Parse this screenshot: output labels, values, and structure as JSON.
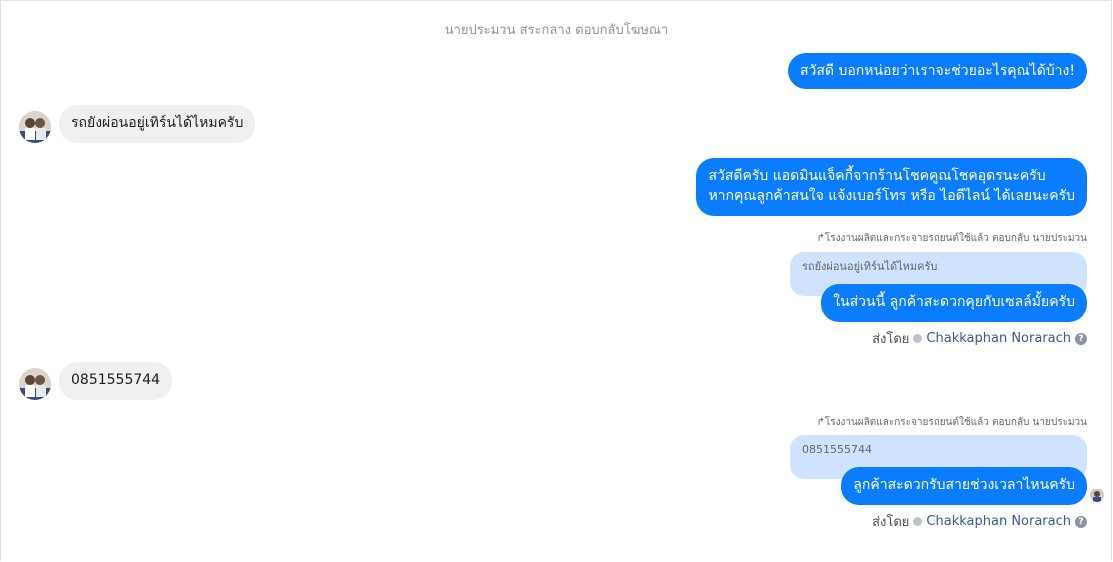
{
  "header": {
    "thread_title": "นายประมวน สระกลาง ตอบกลับโฆษณา"
  },
  "messages": {
    "m1": "สวัสดี บอกหน่อยว่าเราจะช่วยอะไรคุณได้บ้าง!",
    "m2": "รถยังผ่อนอยู่เทิร์นได้ไหมครับ",
    "m3_line1": "สวัสดีครับ แอดมินแจ็คกี้จากร้านโชคคูณโชคอุดรนะครับ",
    "m3_line2": "หากคุณลูกค้าสนใจ แจ้งเบอร์โทร หรือ ไอดีไลน์ ได้เลยนะครับ",
    "reply1_meta": "โรงงานผลิตและกระจายรถยนต์ใช้แล้ว ตอบกลับ นายประมวน",
    "reply1_quote": "รถยังผ่อนอยู่เทิร์นได้ไหมครับ",
    "reply1_text": "ในส่วนนี้ ลูกค้าสะดวกคุยกับเซลล์มั้ยครับ",
    "sent_by_label": "ส่งโดย",
    "sent_by_name": "Chakkaphan Norarach",
    "m5": "0851555744",
    "reply2_meta": "โรงงานผลิตและกระจายรถยนต์ใช้แล้ว ตอบกลับ นายประมวน",
    "reply2_quote": "0851555744",
    "reply2_text": "ลูกค้าสะดวกรับสายช่วงเวลาไหนครับ",
    "sent_by_label2": "ส่งโดย",
    "sent_by_name2": "Chakkaphan Norarach"
  },
  "colors": {
    "outgoing": "#0a7cff",
    "incoming": "#f0f0f0",
    "quoted": "#cfe3ff",
    "link": "#385898"
  },
  "icons": {
    "reply_arrow": "reply-arrow-icon",
    "verified": "verified-icon",
    "help": "help-icon"
  }
}
